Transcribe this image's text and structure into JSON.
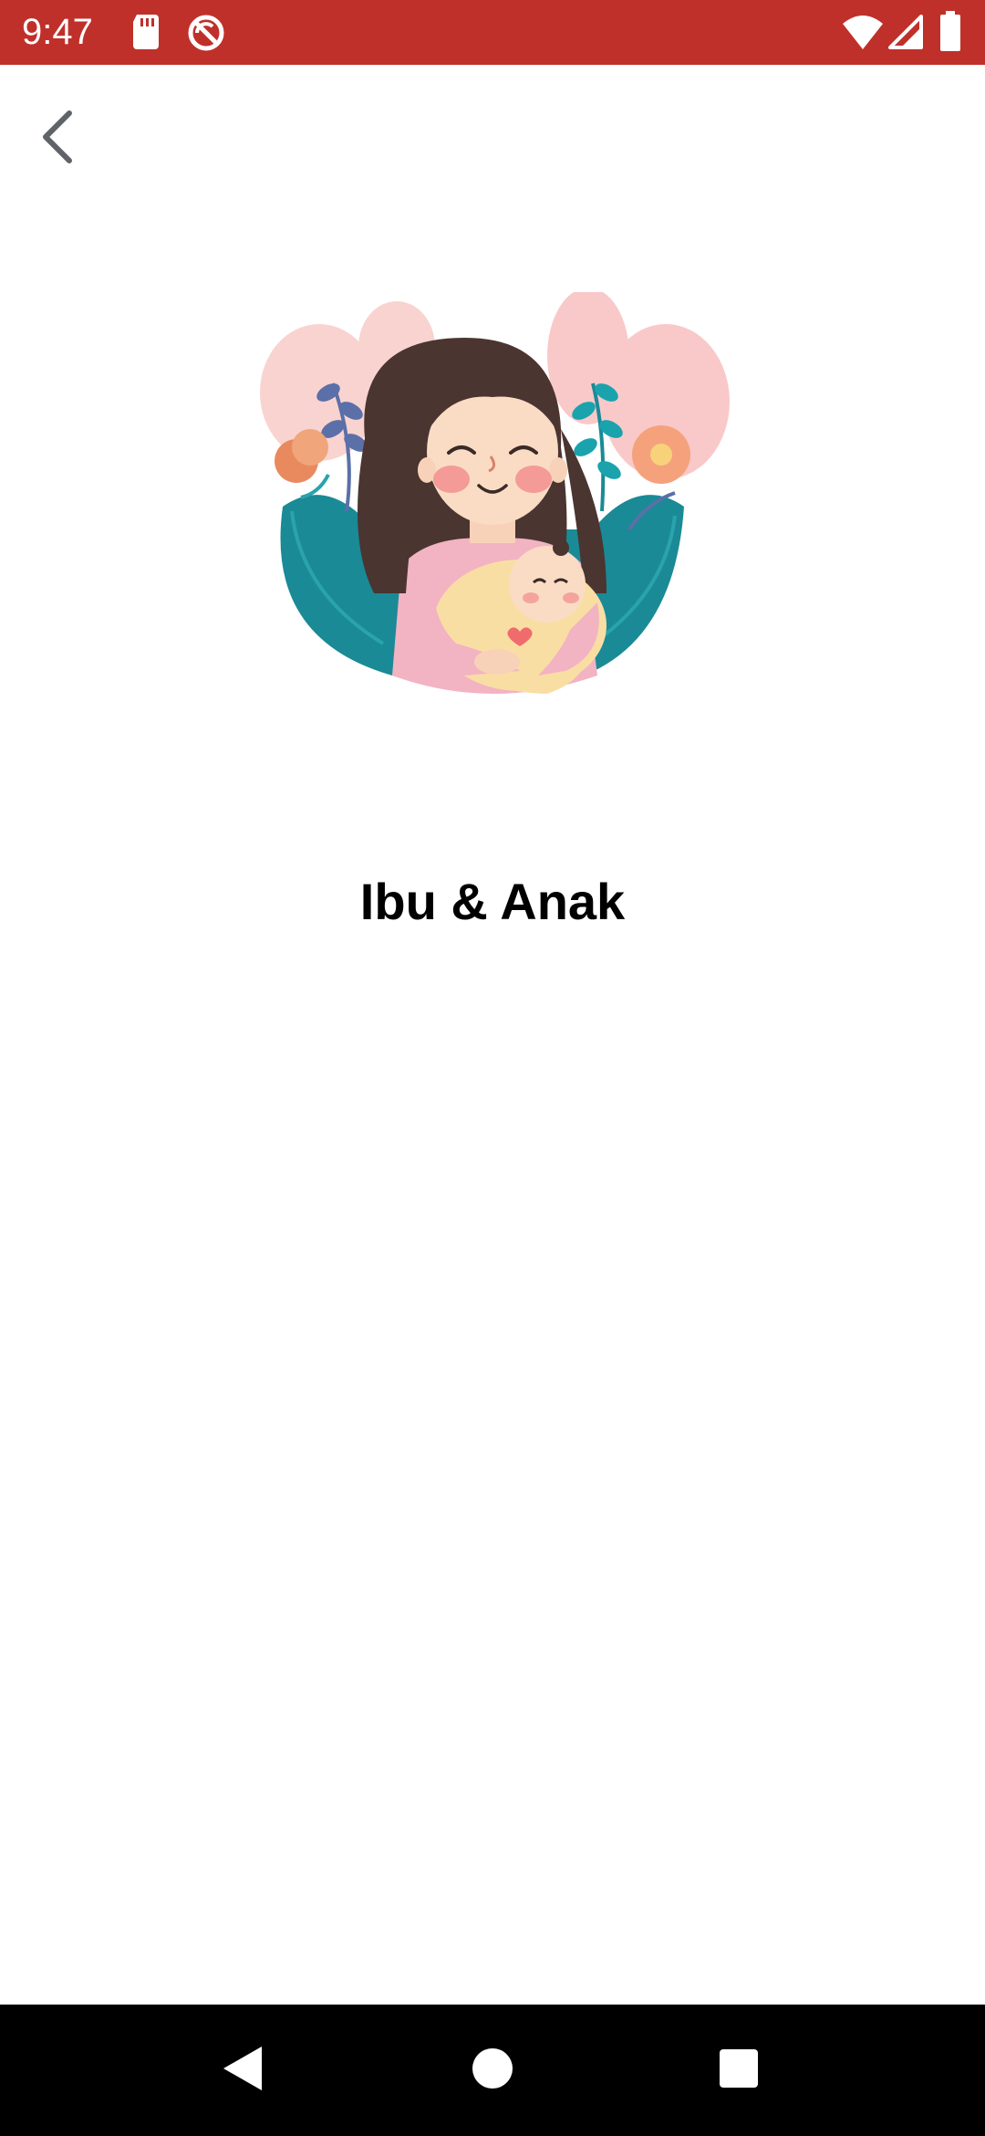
{
  "status_bar": {
    "time": "9:47",
    "background_color": "#c0302a",
    "icons": [
      "sd-card-icon",
      "no-sync-icon",
      "wifi-icon",
      "cell-signal-icon",
      "battery-icon"
    ]
  },
  "header": {
    "back_icon": "chevron-left-icon"
  },
  "illustration": {
    "subject": "mother-holding-baby-illustration"
  },
  "main": {
    "title": "Ibu & Anak"
  },
  "nav_bar": {
    "back_icon": "nav-back-icon",
    "home_icon": "nav-home-icon",
    "recents_icon": "nav-recents-icon"
  }
}
